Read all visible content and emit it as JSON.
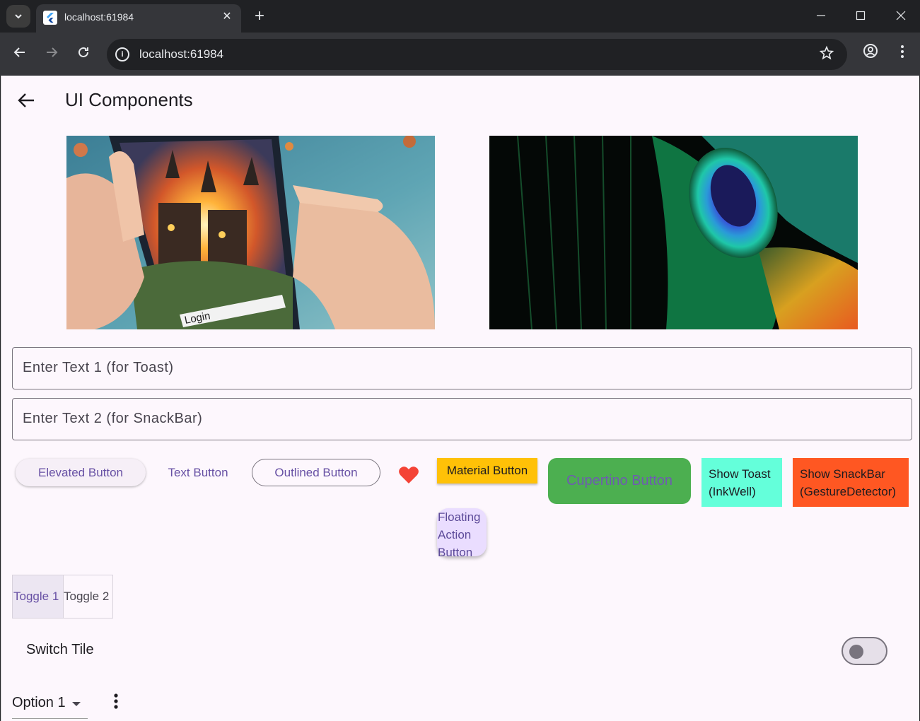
{
  "browser": {
    "tab_title": "localhost:61984",
    "tab_close": "✕",
    "new_tab": "+",
    "url": "localhost:61984",
    "controls": {
      "minimize": "—",
      "maximize": "☐",
      "close": "✕"
    }
  },
  "app": {
    "title": "UI Components",
    "images": [
      {
        "icon": "fantasy-phone-image",
        "caption": "Login"
      },
      {
        "icon": "peacock-feather-image"
      }
    ],
    "text_fields": {
      "toast_placeholder": "Enter Text 1 (for Toast)",
      "snackbar_placeholder": "Enter Text 2 (for SnackBar)"
    },
    "buttons": {
      "elevated": "Elevated Button",
      "text": "Text Button",
      "outlined": "Outlined Button",
      "icon": "heart-icon",
      "material": "Material Button",
      "cupertino": "Cupertino Button",
      "toast": "Show Toast\n(InkWell)",
      "snackbar": "Show SnackBar\n(GestureDetector)",
      "fab": "Floating\nAction\nButton"
    },
    "toggles": [
      "Toggle 1",
      "Toggle 2"
    ],
    "switch_tile": {
      "label": "Switch Tile",
      "value": false
    },
    "dropdown": {
      "value": "Option 1"
    },
    "colors": {
      "primary": "#6750a4",
      "material": "#ffc107",
      "cupertino": "#4caf50",
      "toast": "#64ffda",
      "snackbar": "#ff5722",
      "heart": "#f44336"
    }
  }
}
